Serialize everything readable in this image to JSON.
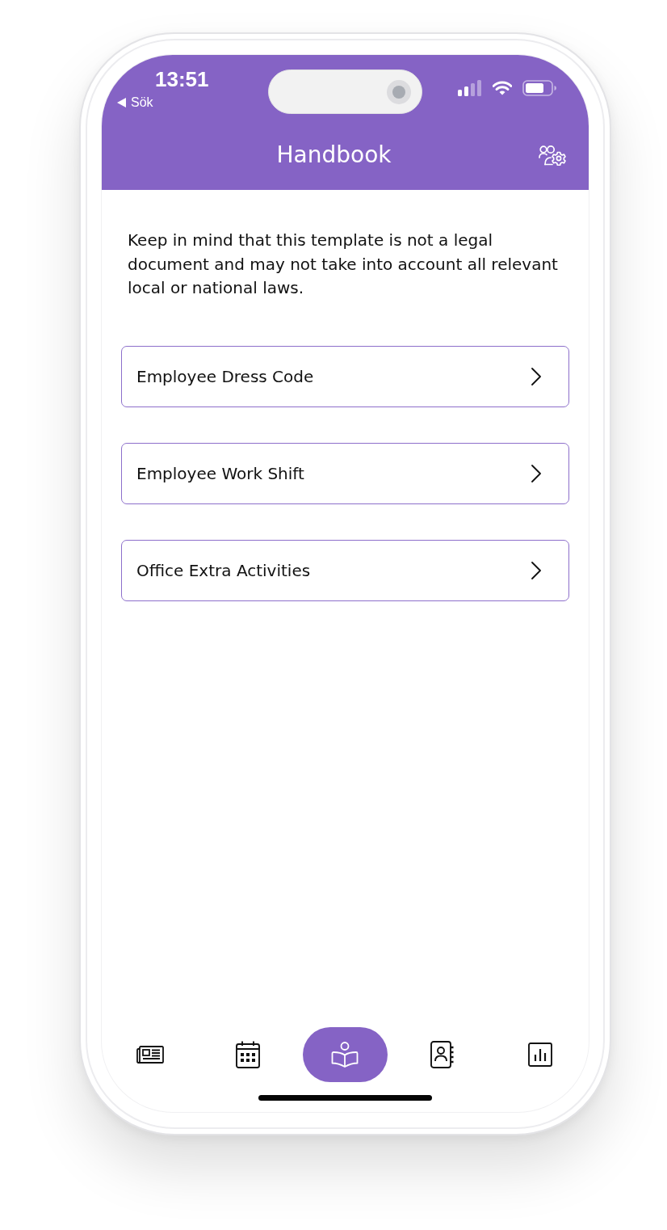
{
  "status_bar": {
    "time": "13:51",
    "back_label": "Sök"
  },
  "header": {
    "title": "Handbook"
  },
  "notice": "Keep in mind that this template is not a legal document and may not take into account all relevant local or national laws.",
  "items": [
    {
      "label": "Employee Dress Code"
    },
    {
      "label": "Employee Work Shift"
    },
    {
      "label": "Office Extra Activities"
    }
  ],
  "bottom_nav": [
    {
      "selected": false
    },
    {
      "selected": false
    },
    {
      "selected": true
    },
    {
      "selected": false
    },
    {
      "selected": false
    }
  ]
}
